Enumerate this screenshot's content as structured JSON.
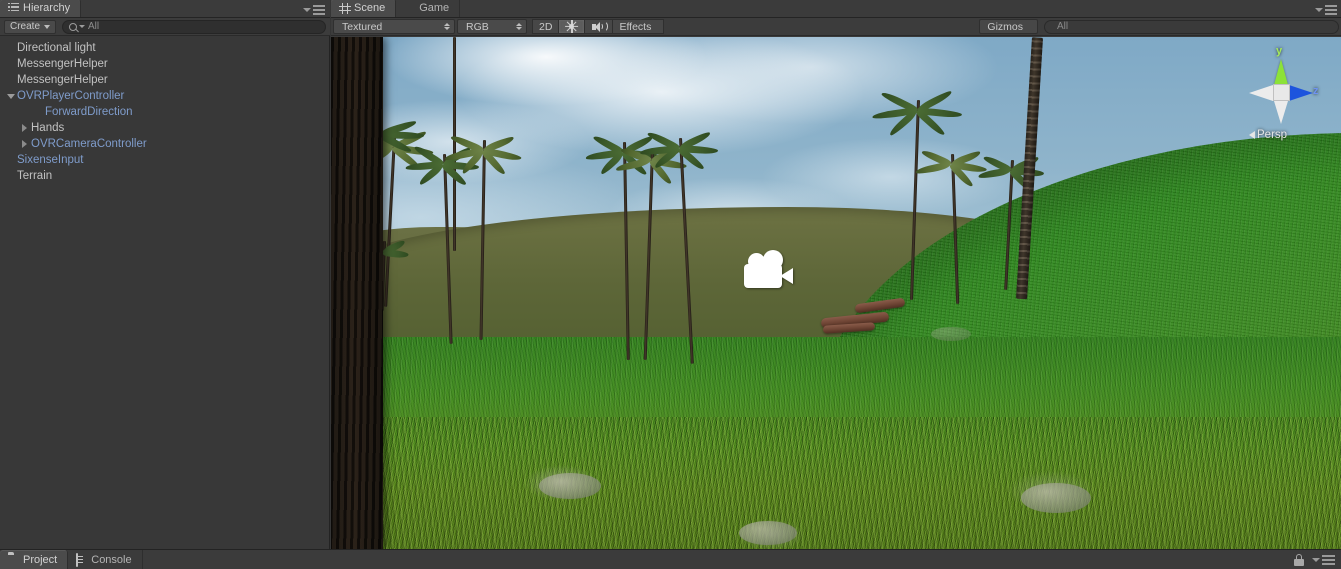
{
  "hierarchy": {
    "tab_label": "Hierarchy",
    "tab_icon": "hierarchy-list-icon",
    "create_label": "Create",
    "search_placeholder": "All",
    "search_value": "",
    "menu_icon": "panel-menu-icon",
    "items": [
      {
        "label": "Directional light",
        "indent": 0,
        "twisty": "none",
        "prefab": false
      },
      {
        "label": "MessengerHelper",
        "indent": 0,
        "twisty": "none",
        "prefab": false
      },
      {
        "label": "MessengerHelper",
        "indent": 0,
        "twisty": "none",
        "prefab": false
      },
      {
        "label": "OVRPlayerController",
        "indent": 0,
        "twisty": "down",
        "prefab": true
      },
      {
        "label": "ForwardDirection",
        "indent": 2,
        "twisty": "none",
        "prefab": true
      },
      {
        "label": "Hands",
        "indent": 1,
        "twisty": "right",
        "prefab": false
      },
      {
        "label": "OVRCameraController",
        "indent": 1,
        "twisty": "right",
        "prefab": true
      },
      {
        "label": "SixenseInput",
        "indent": 0,
        "twisty": "none",
        "prefab": true
      },
      {
        "label": "Terrain",
        "indent": 0,
        "twisty": "none",
        "prefab": false
      }
    ]
  },
  "scene": {
    "tabs": [
      {
        "label": "Scene",
        "icon": "scene-grid-icon",
        "active": true
      },
      {
        "label": "Game",
        "icon": "game-pacman-icon",
        "active": false
      }
    ],
    "menu_icon": "panel-menu-icon",
    "toolbar": {
      "draw_mode": "Textured",
      "color_space": "RGB",
      "toggle_2d": "2D",
      "lighting_icon": "sun-icon",
      "lighting_on": true,
      "audio_icon": "audio-speaker-icon",
      "audio_on": false,
      "effects_label": "Effects",
      "gizmos_label": "Gizmos",
      "search_placeholder": "All",
      "search_value": ""
    },
    "axis_gizmo": {
      "y_label": "y",
      "z_label": "z",
      "projection_label": "Persp",
      "y_color": "#8ce238",
      "z_color": "#1d54dd",
      "hub_color": "#e8e8e8"
    },
    "viewport": {
      "camera_gizmo_name": "camera-gizmo-icon",
      "sky_color": "#7fa9c6",
      "cloud_color": "#ffffff",
      "grass_color": "#3d8a20",
      "far_hill_color": "#5d6638",
      "trunk_color": "#241c15",
      "log_color": "#6e4434"
    }
  },
  "bottom_dock": {
    "tabs": [
      {
        "label": "Project",
        "icon": "folder-icon",
        "active": true
      },
      {
        "label": "Console",
        "icon": "console-icon",
        "active": false
      }
    ],
    "lock_icon": "lock-icon",
    "menu_icon": "panel-menu-icon"
  }
}
